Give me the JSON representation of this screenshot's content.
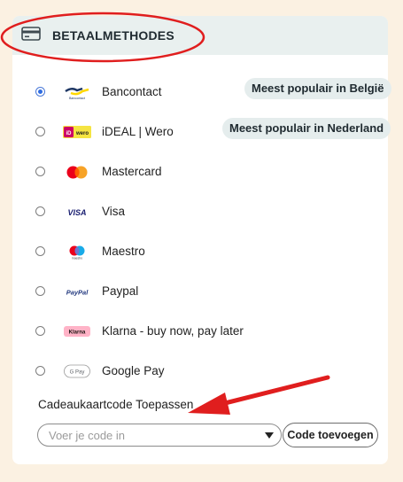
{
  "header": {
    "title": "BETAALMETHODES",
    "icon": "credit-card-icon"
  },
  "methods": [
    {
      "label": "Bancontact",
      "icon": "bancontact-logo",
      "selected": true,
      "badge": "Meest populair in België"
    },
    {
      "label": "iDEAL | Wero",
      "icon": "ideal-wero-logo",
      "selected": false,
      "badge": "Meest populair in Nederland"
    },
    {
      "label": "Mastercard",
      "icon": "mastercard-logo",
      "selected": false
    },
    {
      "label": "Visa",
      "icon": "visa-logo",
      "selected": false
    },
    {
      "label": "Maestro",
      "icon": "maestro-logo",
      "selected": false
    },
    {
      "label": "Paypal",
      "icon": "paypal-logo",
      "selected": false
    },
    {
      "label": "Klarna - buy now, pay later",
      "icon": "klarna-logo",
      "selected": false
    },
    {
      "label": "Google Pay",
      "icon": "google-pay-logo",
      "selected": false
    }
  ],
  "logo_text": {
    "bancontact": "Bancontact",
    "ideal": "iD",
    "wero": "wero",
    "visa": "VISA",
    "maestro": "maestro",
    "paypal": "PayPal",
    "klarna": "Klarna",
    "gpay": "G Pay"
  },
  "gift_card": {
    "label": "Cadeaukaartcode Toepassen",
    "placeholder": "Voer je code in",
    "button_label": "Code toevoegen"
  },
  "colors": {
    "page_background": "#fbf1e2",
    "header_background": "#e9f0ef",
    "annotation_red": "#e01e1e",
    "radio_selected": "#2f6ce0"
  }
}
